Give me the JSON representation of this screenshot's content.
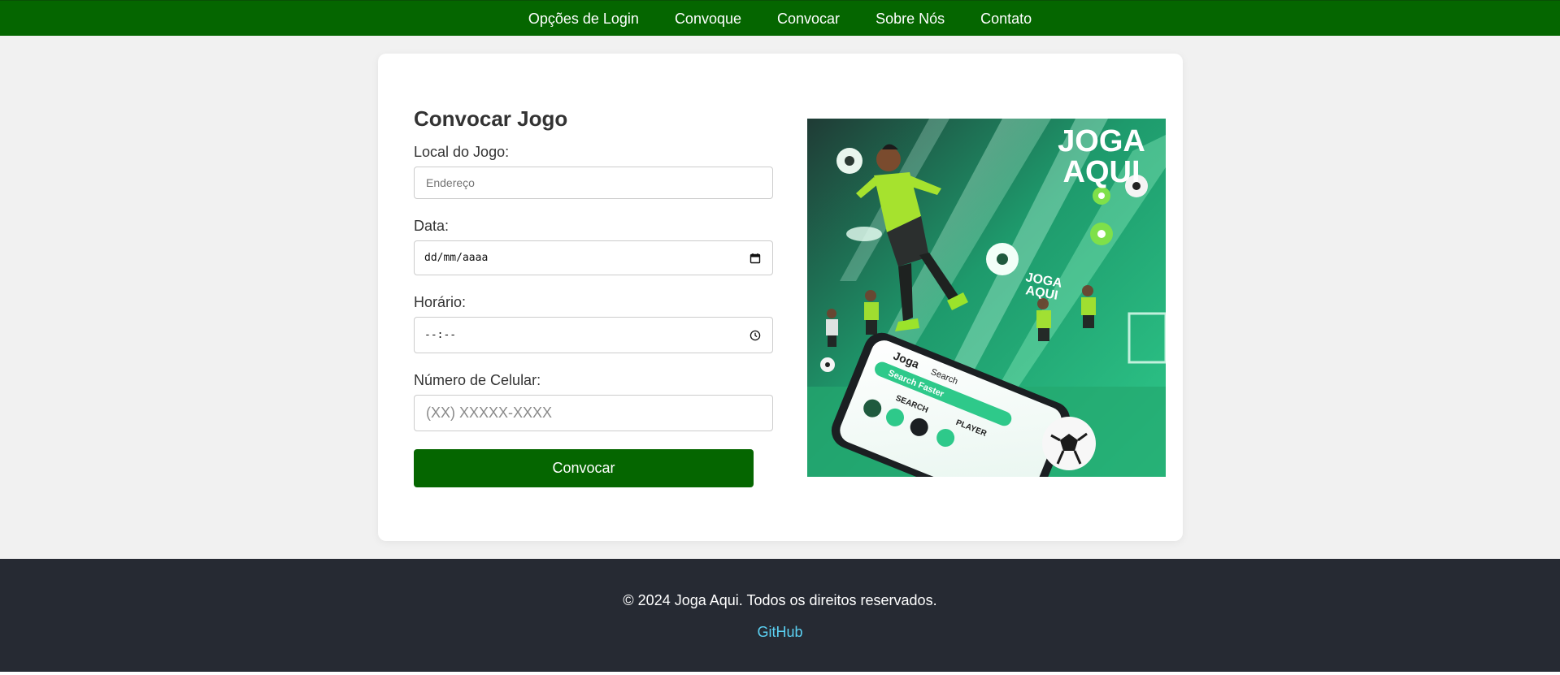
{
  "nav": {
    "items": [
      {
        "label": "Opções de Login"
      },
      {
        "label": "Convoque"
      },
      {
        "label": "Convocar"
      },
      {
        "label": "Sobre Nós"
      },
      {
        "label": "Contato"
      }
    ]
  },
  "form": {
    "title": "Convocar Jogo",
    "local": {
      "label": "Local do Jogo:",
      "placeholder": "Endereço",
      "value": ""
    },
    "date": {
      "label": "Data:",
      "display": "dd/mm/aaaa",
      "icon": "calendar-icon"
    },
    "time": {
      "label": "Horário:",
      "display": "--:--",
      "icon": "clock-icon"
    },
    "phone": {
      "label": "Número de Celular:",
      "placeholder": "(XX) XXXXX-XXXX",
      "value": ""
    },
    "submit_label": "Convocar"
  },
  "hero": {
    "brand_text_1": "JOGA",
    "brand_text_2": "AQUI",
    "phone_text_1": "Joga",
    "phone_text_2": "Search",
    "phone_text_3": "Search Faster",
    "phone_text_4": "SEARCH",
    "phone_text_5": "PLAYER"
  },
  "footer": {
    "copyright": "© 2024 Joga Aqui. Todos os direitos reservados.",
    "link_label": "GitHub"
  },
  "colors": {
    "nav_bg": "#056600",
    "button_bg": "#056600",
    "footer_bg": "#262a33",
    "link": "#5bd0f2",
    "jersey": "#a6e22e"
  }
}
